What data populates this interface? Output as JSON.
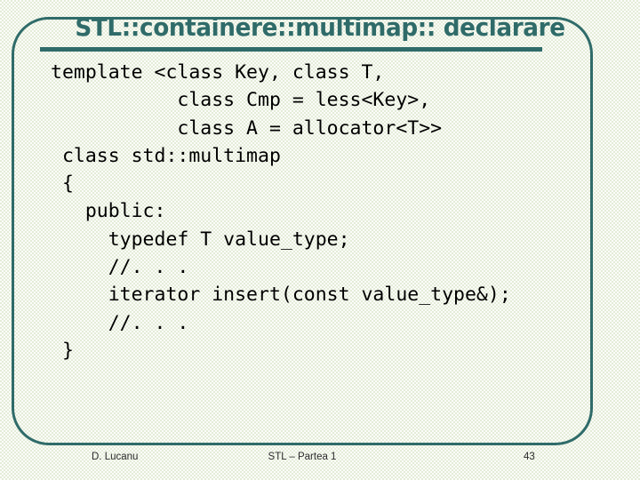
{
  "slide": {
    "title": "STL::containere::multimap:: declarare",
    "accent_color": "#2f6b69",
    "background_color": "#e4ecd8",
    "code_lines": [
      "template <class Key, class T,",
      "           class Cmp = less<Key>,",
      "           class A = allocator<T>>",
      " class std::multimap",
      " {",
      "   public:",
      "     typedef T value_type;",
      "     //. . .",
      "     iterator insert(const value_type&);",
      "     //. . .",
      " }"
    ],
    "footer": {
      "author": "D. Lucanu",
      "subject": "STL – Partea 1",
      "page_number": "43"
    }
  }
}
